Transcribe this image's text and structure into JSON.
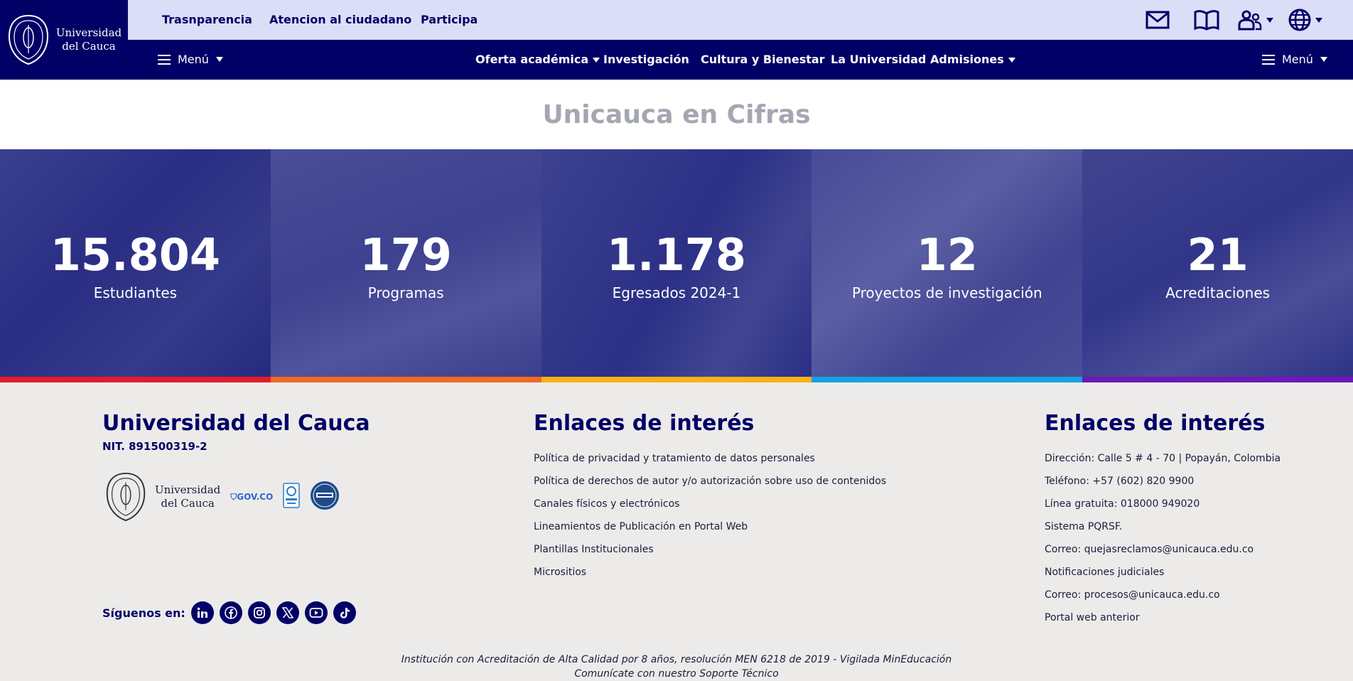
{
  "header": {
    "logo_line1": "Universidad",
    "logo_line2": "del Cauca",
    "top_links": [
      "Trasnparencia",
      "Atencion al ciudadano",
      "Participa"
    ],
    "icons": [
      "mail-icon",
      "book-icon",
      "people-icon",
      "globe-icon"
    ],
    "left_menu_label": "Menú",
    "right_menu_label": "Menú",
    "nav": {
      "oferta": "Oferta académica",
      "investigacion": "Investigación",
      "cultura": "Cultura y Bienestar",
      "universidad": "La Universidad",
      "admisiones": "Admisiones"
    }
  },
  "title": "Unicauca en Cifras",
  "stats": [
    {
      "value": "15.804",
      "label": "Estudiantes",
      "color": "#E31C2B"
    },
    {
      "value": "179",
      "label": "Programas",
      "color": "#F26A21"
    },
    {
      "value": "1.178",
      "label": "Egresados 2024-1",
      "color": "#F9B115"
    },
    {
      "value": "12",
      "label": "Proyectos de investigación",
      "color": "#13A3E1"
    },
    {
      "value": "21",
      "label": "Acreditaciones",
      "color": "#6E18B8"
    }
  ],
  "footer": {
    "col1": {
      "title": "Universidad del Cauca",
      "nit": "NIT. 891500319-2",
      "logo_line1": "Universidad",
      "logo_line2": "del Cauca",
      "gov": "GOV.CO",
      "social_label": "Síguenos en:",
      "social_icons": [
        "linkedin-icon",
        "facebook-icon",
        "instagram-icon",
        "x-icon",
        "youtube-icon",
        "tiktok-icon"
      ]
    },
    "col2": {
      "title": "Enlaces de interés",
      "links": [
        "Política de privacidad y tratamiento de datos personales",
        "Política de derechos de autor y/o autorización sobre uso de contenidos",
        "Canales físicos y electrónicos",
        "Lineamientos de Publicación en Portal Web",
        "Plantillas Institucionales",
        "Micrositios"
      ]
    },
    "col3": {
      "title": "Enlaces de interés",
      "links": [
        "Dirección: Calle 5 # 4 - 70 | Popayán, Colombia",
        "Teléfono: +57 (602) 820 9900",
        "Línea gratuita: 018000 949020",
        "Sistema PQRSF.",
        "Correo: quejasreclamos@unicauca.edu.co",
        "Notificaciones judiciales",
        "Correo: procesos@unicauca.edu.co",
        "Portal web anterior"
      ]
    },
    "legal_line1": "Institución con Acreditación de Alta Calidad por 8 años, resolución MEN 6218 de 2019 - Vigilada MinEducación",
    "legal_line2": "Comunícate con nuestro Soporte Técnico"
  }
}
